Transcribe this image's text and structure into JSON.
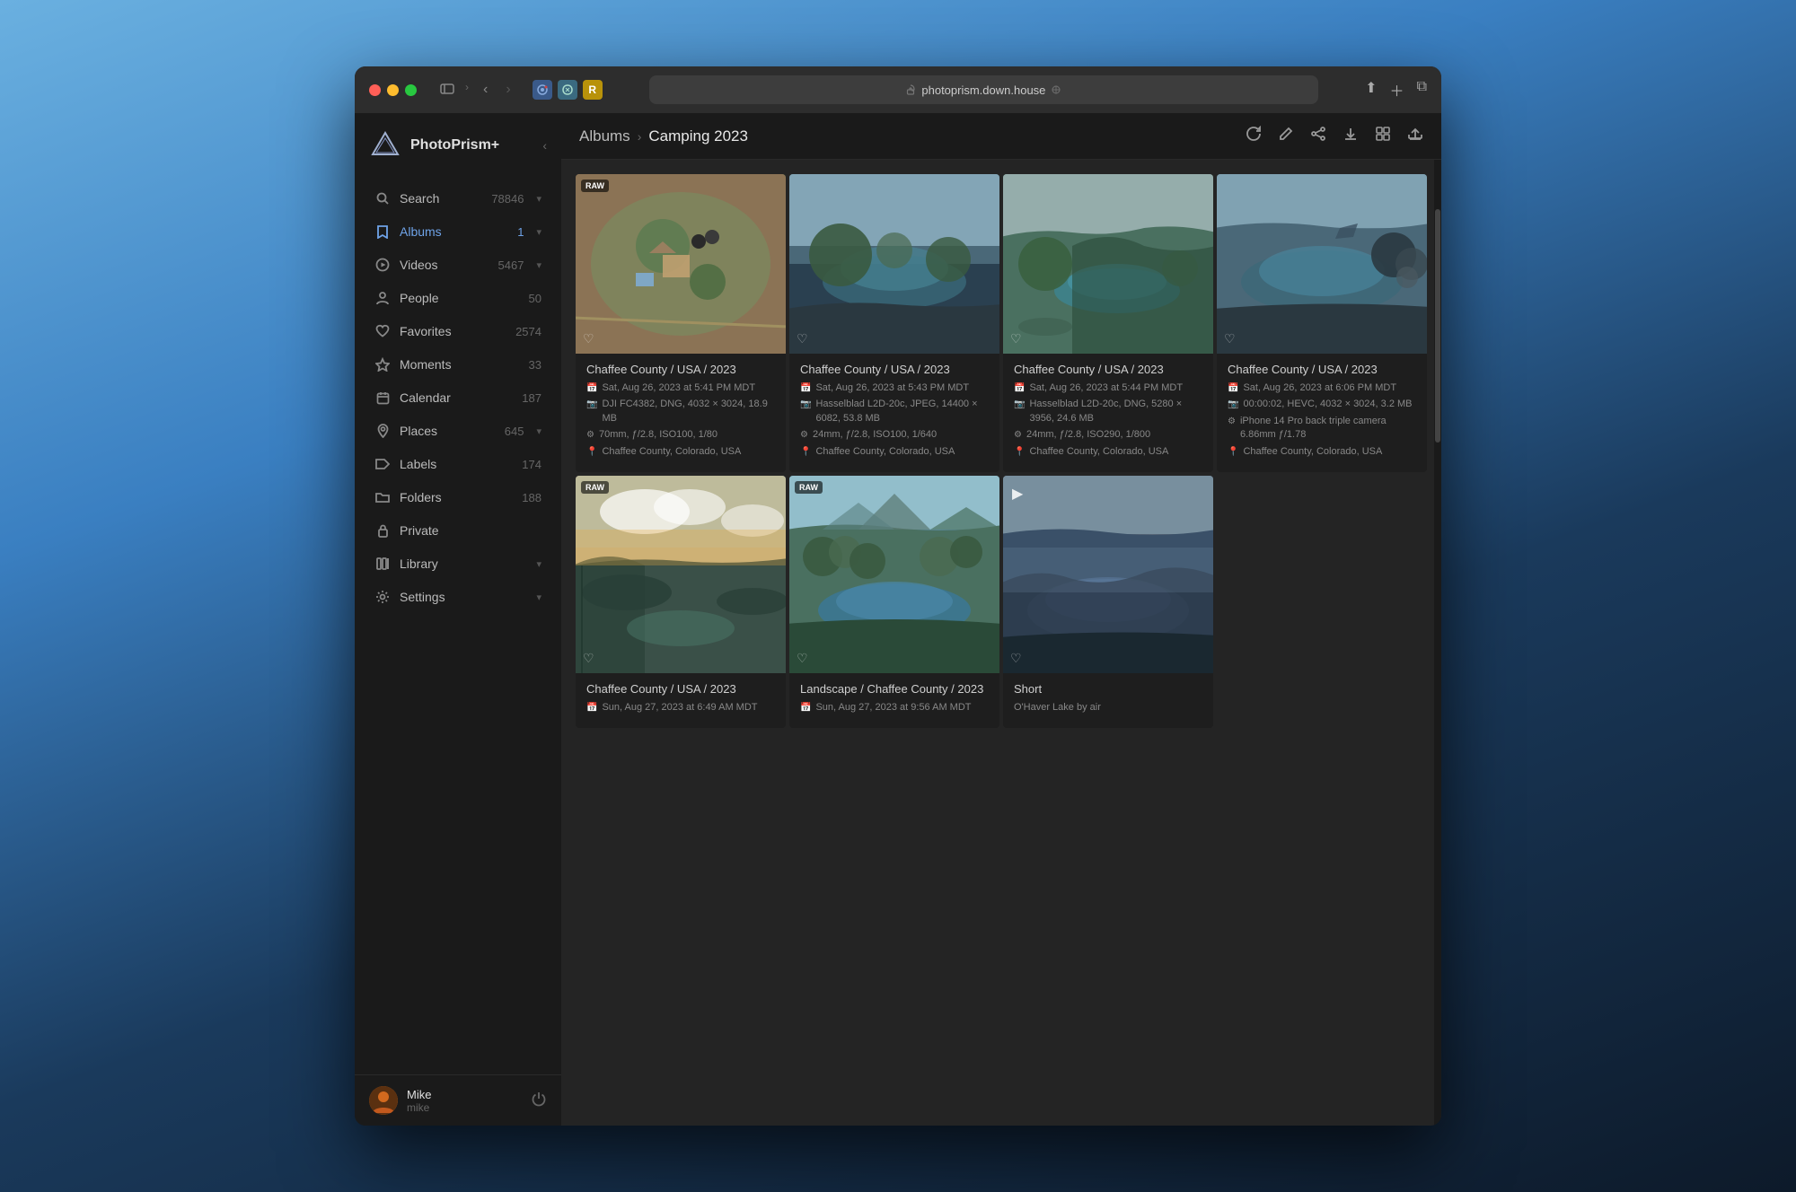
{
  "browser": {
    "url": "photoprism.down.house",
    "tab_icons": [
      "🔒"
    ],
    "extension_icons": [
      {
        "id": "ext1",
        "char": "🔵",
        "bg": "#4a90d9"
      },
      {
        "id": "ext2",
        "char": "🔷",
        "bg": "#5a7fa0"
      },
      {
        "id": "ext3",
        "char": "R",
        "bg": "#c8a020"
      }
    ]
  },
  "app": {
    "title": "PhotoPrism+",
    "logo_colors": [
      "#a0a0c0",
      "#d0d0e8"
    ]
  },
  "sidebar": {
    "items": [
      {
        "id": "search",
        "label": "Search",
        "count": "78846",
        "icon": "search",
        "has_chevron": true,
        "active": false
      },
      {
        "id": "albums",
        "label": "Albums",
        "count": "1",
        "icon": "bookmark",
        "has_chevron": true,
        "active": true
      },
      {
        "id": "videos",
        "label": "Videos",
        "count": "5467",
        "icon": "play-circle",
        "has_chevron": true,
        "active": false
      },
      {
        "id": "people",
        "label": "People",
        "count": "50",
        "icon": "person",
        "has_chevron": false,
        "active": false
      },
      {
        "id": "favorites",
        "label": "Favorites",
        "count": "2574",
        "icon": "heart",
        "has_chevron": false,
        "active": false
      },
      {
        "id": "moments",
        "label": "Moments",
        "count": "33",
        "icon": "star",
        "has_chevron": false,
        "active": false
      },
      {
        "id": "calendar",
        "label": "Calendar",
        "count": "187",
        "icon": "calendar",
        "has_chevron": false,
        "active": false
      },
      {
        "id": "places",
        "label": "Places",
        "count": "645",
        "icon": "location",
        "has_chevron": true,
        "active": false
      },
      {
        "id": "labels",
        "label": "Labels",
        "count": "174",
        "icon": "label",
        "has_chevron": false,
        "active": false
      },
      {
        "id": "folders",
        "label": "Folders",
        "count": "188",
        "icon": "folder",
        "has_chevron": false,
        "active": false
      },
      {
        "id": "private",
        "label": "Private",
        "count": "",
        "icon": "lock",
        "has_chevron": false,
        "active": false
      },
      {
        "id": "library",
        "label": "Library",
        "count": "",
        "icon": "library",
        "has_chevron": true,
        "active": false
      },
      {
        "id": "settings",
        "label": "Settings",
        "count": "",
        "icon": "settings",
        "has_chevron": true,
        "active": false
      }
    ],
    "user": {
      "name": "Mike",
      "login": "mike"
    }
  },
  "breadcrumb": {
    "parent": "Albums",
    "current": "Camping 2023"
  },
  "toolbar": {
    "buttons": [
      "refresh",
      "edit",
      "share",
      "download",
      "view",
      "upload"
    ]
  },
  "photos": [
    {
      "id": 1,
      "thumb_class": "thumb-1",
      "badge": "RAW",
      "badge_visible": true,
      "play_visible": false,
      "location": "Chaffee County / USA / 2023",
      "date": "Sat, Aug 26, 2023 at 5:41 PM MDT",
      "camera": "DJI FC4382, DNG, 4032 × 3024, 18.9 MB",
      "lens": "70mm, ƒ/2.8, ISO100, 1/80",
      "place": "Chaffee County, Colorado, USA",
      "row": 1
    },
    {
      "id": 2,
      "thumb_class": "thumb-2",
      "badge": "",
      "badge_visible": false,
      "play_visible": false,
      "location": "Chaffee County / USA / 2023",
      "date": "Sat, Aug 26, 2023 at 5:43 PM MDT",
      "camera": "Hasselblad L2D-20c, JPEG, 14400 × 6082, 53.8 MB",
      "lens": "24mm, ƒ/2.8, ISO100, 1/640",
      "place": "Chaffee County, Colorado, USA",
      "row": 1
    },
    {
      "id": 3,
      "thumb_class": "thumb-3",
      "badge": "",
      "badge_visible": false,
      "play_visible": false,
      "location": "Chaffee County / USA / 2023",
      "date": "Sat, Aug 26, 2023 at 5:44 PM MDT",
      "camera": "Hasselblad L2D-20c, DNG, 5280 × 3956, 24.6 MB",
      "lens": "24mm, ƒ/2.8, ISO290, 1/800",
      "place": "Chaffee County, Colorado, USA",
      "row": 1
    },
    {
      "id": 4,
      "thumb_class": "thumb-4",
      "badge": "",
      "badge_visible": false,
      "play_visible": false,
      "location": "Chaffee County / USA / 2023",
      "date": "Sat, Aug 26, 2023 at 6:06 PM MDT",
      "camera": "00:00:02, HEVC, 4032 × 3024, 3.2 MB",
      "lens": "iPhone 14 Pro back triple camera 6.86mm ƒ/1.78",
      "place": "Chaffee County, Colorado, USA",
      "row": 1
    },
    {
      "id": 5,
      "thumb_class": "thumb-5",
      "badge": "RAW",
      "badge_visible": true,
      "play_visible": false,
      "location": "Chaffee County / USA / 2023",
      "date": "Sun, Aug 27, 2023 at 6:49 AM MDT",
      "camera": "",
      "lens": "",
      "place": "",
      "row": 2
    },
    {
      "id": 6,
      "thumb_class": "thumb-6",
      "badge": "RAW",
      "badge_visible": true,
      "play_visible": false,
      "location": "Landscape / Chaffee County / 2023",
      "date": "Sun, Aug 27, 2023 at 9:56 AM MDT",
      "camera": "",
      "lens": "",
      "place": "",
      "row": 2
    },
    {
      "id": 7,
      "thumb_class": "thumb-7",
      "badge": "",
      "badge_visible": false,
      "play_visible": true,
      "location": "Short",
      "date": "O'Haver Lake by air",
      "camera": "",
      "lens": "",
      "place": "",
      "row": 2
    }
  ]
}
